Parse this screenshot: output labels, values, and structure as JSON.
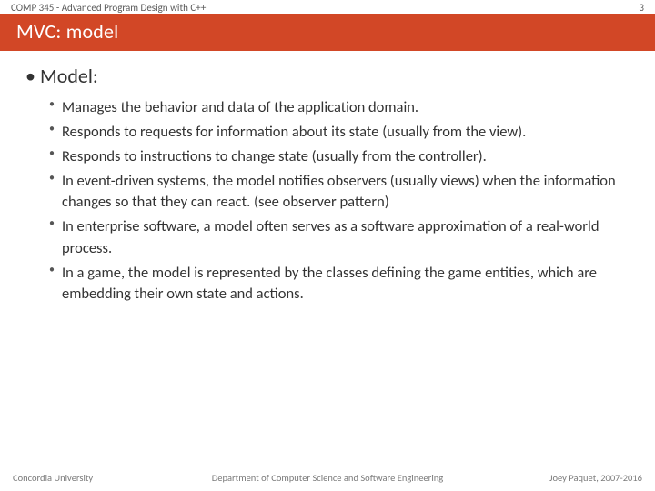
{
  "header": {
    "course": "COMP 345 - Advanced Program Design with C++",
    "page_number": "3",
    "title": "MVC: model"
  },
  "content": {
    "heading": "Model:",
    "bullets": [
      "Manages the behavior and data of the application domain.",
      "Responds to requests for information about its state (usually from the view).",
      "Responds to instructions to change state (usually from the controller).",
      "In event-driven systems, the model notifies observers (usually views) when the information changes so that they can react. (see observer pattern)",
      "In enterprise software, a model often serves as a software approximation of a real-world process.",
      "In a game, the model is represented by the classes defining the game entities, which are embedding their own state and actions."
    ]
  },
  "footer": {
    "left": "Concordia University",
    "center": "Department of Computer Science and Software Engineering",
    "right": "Joey Paquet, 2007-2016"
  }
}
